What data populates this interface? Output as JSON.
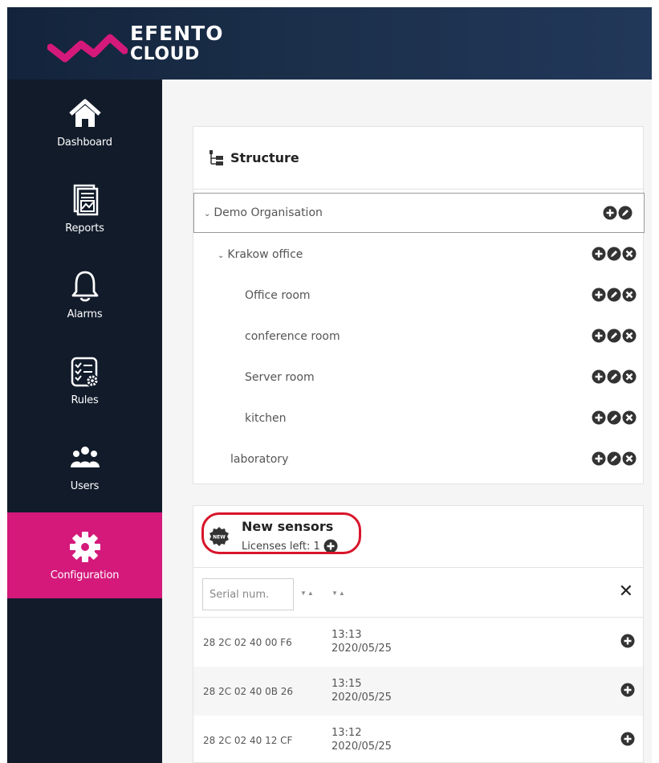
{
  "brand": {
    "line1": "EFENTO",
    "line2": "CLOUD"
  },
  "sidebar": {
    "items": [
      {
        "label": "Dashboard",
        "icon": "home-icon"
      },
      {
        "label": "Reports",
        "icon": "report-icon"
      },
      {
        "label": "Alarms",
        "icon": "bell-icon"
      },
      {
        "label": "Rules",
        "icon": "rules-icon"
      },
      {
        "label": "Users",
        "icon": "users-icon"
      },
      {
        "label": "Configuration",
        "icon": "gear-icon",
        "active": true
      }
    ]
  },
  "structure": {
    "title": "Structure",
    "rows": [
      {
        "label": "Demo Organisation",
        "prefix": "˅",
        "actions": [
          "add",
          "edit"
        ]
      },
      {
        "label": "Krakow office",
        "prefix": "˅",
        "actions": [
          "add",
          "edit",
          "delete"
        ]
      },
      {
        "label": "Office room",
        "actions": [
          "add",
          "edit",
          "delete"
        ]
      },
      {
        "label": "conference room",
        "actions": [
          "add",
          "edit",
          "delete"
        ]
      },
      {
        "label": "Server room",
        "actions": [
          "add",
          "edit",
          "delete"
        ]
      },
      {
        "label": "kitchen",
        "actions": [
          "add",
          "edit",
          "delete"
        ]
      },
      {
        "label": "laboratory",
        "actions": [
          "add",
          "edit",
          "delete"
        ]
      }
    ]
  },
  "new_sensors": {
    "title": "New sensors",
    "licenses_label": "Licenses left: 1",
    "serial_placeholder": "Serial num.",
    "rows": [
      {
        "serial": "28 2C 02 40 00 F6",
        "time": "13:13",
        "date": "2020/05/25"
      },
      {
        "serial": "28 2C 02 40 0B 26",
        "time": "13:15",
        "date": "2020/05/25"
      },
      {
        "serial": "28 2C 02 40 12 CF",
        "time": "13:12",
        "date": "2020/05/25"
      }
    ]
  },
  "colors": {
    "accent": "#d4197b",
    "sidebar": "#111b2a",
    "header": "#1b2f4a",
    "highlight": "#d8152b"
  }
}
